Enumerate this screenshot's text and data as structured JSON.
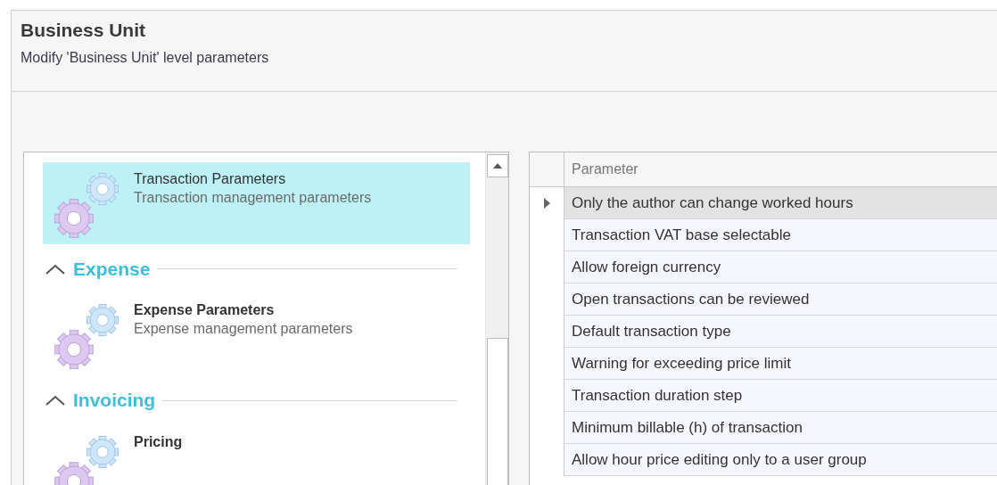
{
  "header": {
    "title": "Business Unit",
    "subtitle": "Modify 'Business Unit' level parameters"
  },
  "parameter_list": [
    {
      "kind": "item",
      "title": "Transaction Parameters",
      "description": "Transaction management parameters",
      "selected": true
    },
    {
      "kind": "group",
      "title": "Expense",
      "expanded": true
    },
    {
      "kind": "item",
      "title": "Expense Parameters",
      "description": "Expense management parameters",
      "selected": false
    },
    {
      "kind": "group",
      "title": "Invoicing",
      "expanded": true
    },
    {
      "kind": "item",
      "title": "Pricing",
      "selected": false
    }
  ],
  "grid": {
    "columns": [
      "Parameter"
    ],
    "rows": [
      {
        "parameter": "Only the author can change worked hours",
        "selected": true
      },
      {
        "parameter": "Transaction VAT base selectable",
        "selected": false
      },
      {
        "parameter": "Allow foreign currency",
        "selected": false
      },
      {
        "parameter": "Open transactions can be reviewed",
        "selected": false
      },
      {
        "parameter": "Default transaction type",
        "selected": false
      },
      {
        "parameter": "Warning for exceeding price limit",
        "selected": false
      },
      {
        "parameter": "Transaction duration step",
        "selected": false
      },
      {
        "parameter": "Minimum billable (h) of transaction",
        "selected": false
      },
      {
        "parameter": "Allow hour price editing only to a user group",
        "selected": false
      }
    ]
  }
}
